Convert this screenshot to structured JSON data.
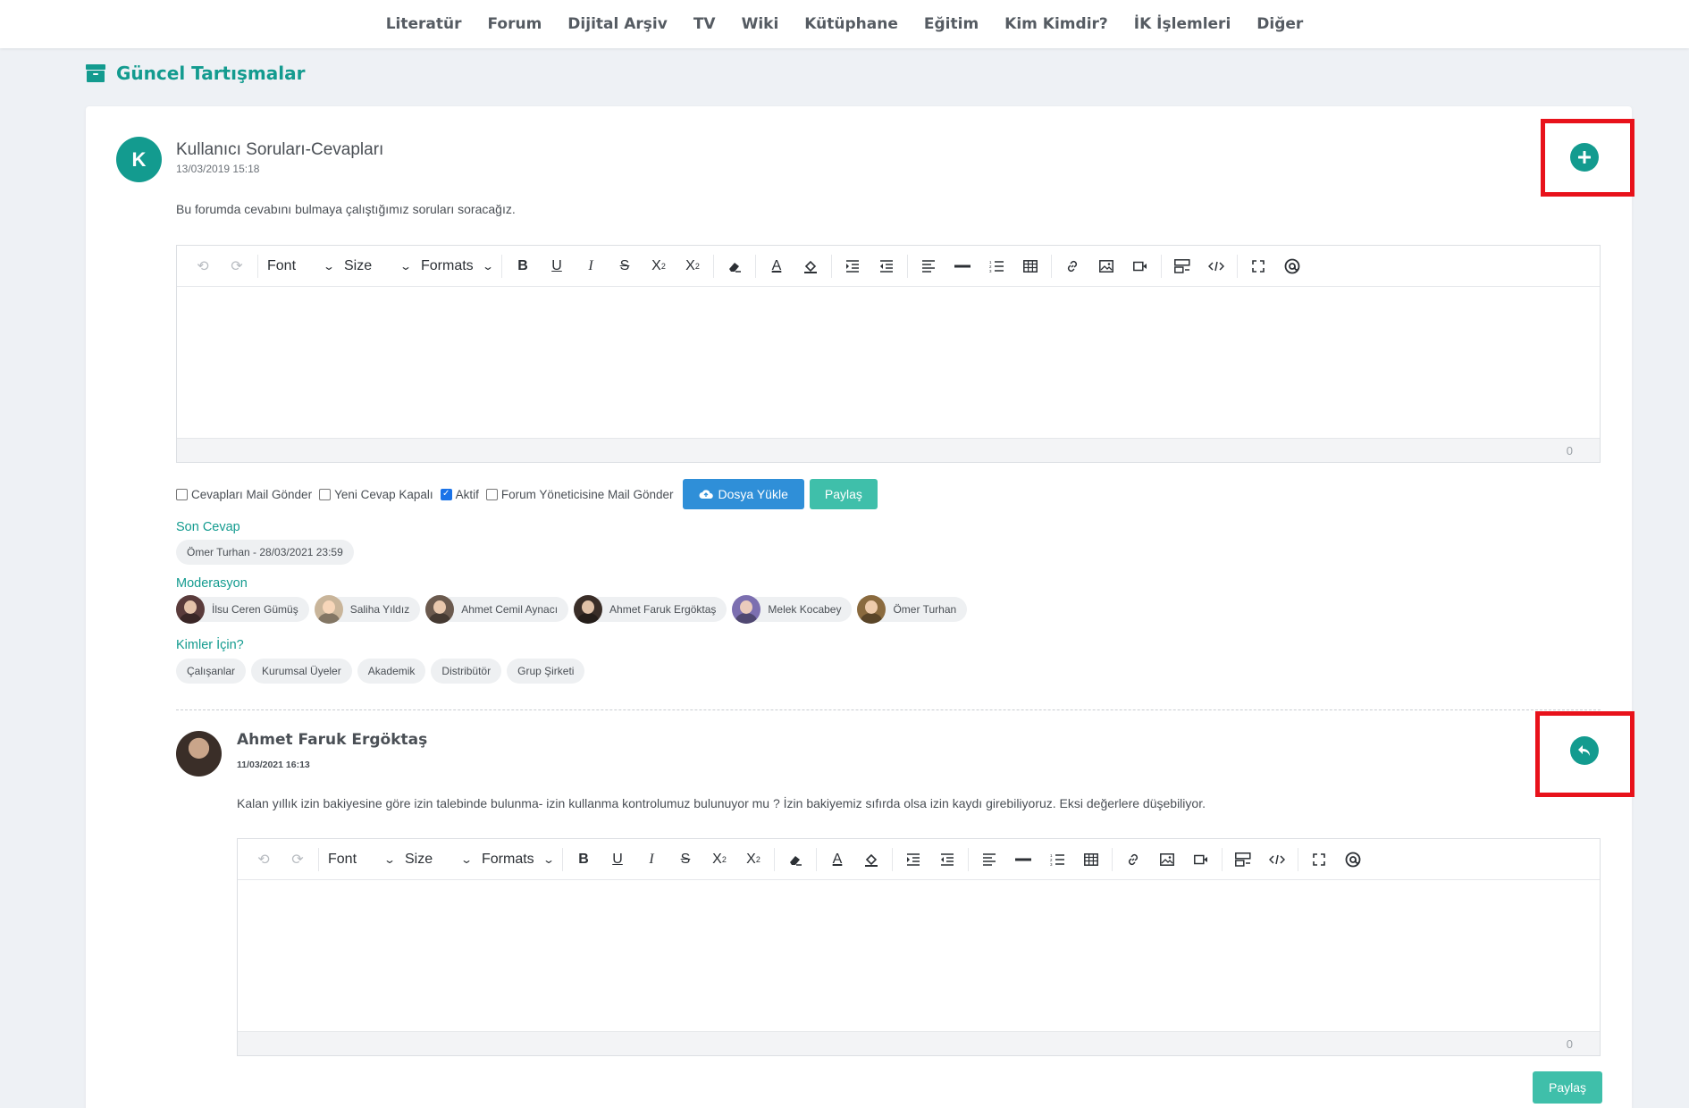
{
  "nav": {
    "items": [
      "Literatür",
      "Forum",
      "Dijital Arşiv",
      "TV",
      "Wiki",
      "Kütüphane",
      "Eğitim",
      "Kim Kimdir?",
      "İK İşlemleri",
      "Diğer"
    ]
  },
  "page": {
    "heading": "Güncel Tartışmalar",
    "heading_icon": "archive-icon",
    "accent_color": "#139b8f"
  },
  "forum": {
    "avatar_letter": "K",
    "title": "Kullanıcı Soruları-Cevapları",
    "date": "13/03/2019 15:18",
    "description": "Bu forumda cevabını bulmaya çalıştığımız soruları soracağız.",
    "add_icon": "plus-circle-icon"
  },
  "editor": {
    "font_label": "Font",
    "size_label": "Size",
    "formats_label": "Formats",
    "char_count": "0"
  },
  "options": {
    "mail_answers": {
      "label": "Cevapları Mail Gönder",
      "checked": false
    },
    "new_answer_closed": {
      "label": "Yeni Cevap Kapalı",
      "checked": false
    },
    "active": {
      "label": "Aktif",
      "checked": true
    },
    "mail_admin": {
      "label": "Forum Yöneticisine Mail Gönder",
      "checked": false
    },
    "upload_label": "Dosya Yükle",
    "share_label": "Paylaş"
  },
  "last_answer": {
    "label": "Son Cevap",
    "value": "Ömer Turhan - 28/03/2021 23:59"
  },
  "moderation": {
    "label": "Moderasyon",
    "people": [
      {
        "name": "İlsu Ceren Gümüş",
        "color": "#5a3b3b"
      },
      {
        "name": "Saliha Yıldız",
        "color": "#c9b59a"
      },
      {
        "name": "Ahmet Cemil Aynacı",
        "color": "#6b5a4e"
      },
      {
        "name": "Ahmet Faruk Ergöktaş",
        "color": "#3a2e28"
      },
      {
        "name": "Melek Kocabey",
        "color": "#7c6fb0"
      },
      {
        "name": "Ömer Turhan",
        "color": "#8a6a3e"
      }
    ]
  },
  "audience": {
    "label": "Kimler İçin?",
    "tags": [
      "Çalışanlar",
      "Kurumsal Üyeler",
      "Akademik",
      "Distribütör",
      "Grup Şirketi"
    ]
  },
  "reply": {
    "author": "Ahmet Faruk Ergöktaş",
    "date": "11/03/2021 16:13",
    "text": "Kalan yıllık izin bakiyesine göre izin talebinde bulunma- izin kullanma kontrolumuz bulunuyor mu ? İzin bakiyemiz sıfırda olsa izin kaydı girebiliyoruz. Eksi değerlere düşebiliyor.",
    "reply_icon": "reply-circle-icon",
    "share_label": "Paylaş"
  }
}
